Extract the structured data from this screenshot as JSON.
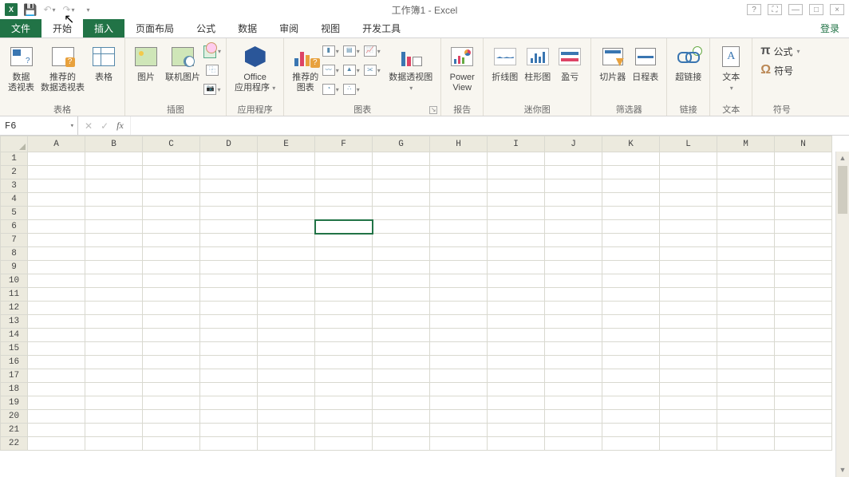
{
  "title": "工作簿1 - Excel",
  "login": "登录",
  "tabs": {
    "file": "文件",
    "home": "开始",
    "insert": "插入",
    "pagelayout": "页面布局",
    "formulas": "公式",
    "data": "数据",
    "review": "审阅",
    "view": "视图",
    "developer": "开发工具"
  },
  "active_tab": "insert",
  "ribbon": {
    "g_tables": {
      "label": "表格",
      "pivot": "数据\n透视表",
      "rec_pivot": "推荐的\n数据透视表",
      "table": "表格"
    },
    "g_illus": {
      "label": "插图",
      "pic": "图片",
      "online": "联机图片"
    },
    "g_apps": {
      "label": "应用程序",
      "office": "Office\n应用程序"
    },
    "g_charts": {
      "label": "图表",
      "rec": "推荐的\n图表",
      "pivotchart": "数据透视图"
    },
    "g_reports": {
      "label": "报告",
      "powerview": "Power\nView"
    },
    "g_spark": {
      "label": "迷你图",
      "line": "折线图",
      "column": "柱形图",
      "winloss": "盈亏"
    },
    "g_filters": {
      "label": "筛选器",
      "slicer": "切片器",
      "timeline": "日程表"
    },
    "g_links": {
      "label": "链接",
      "hyperlink": "超链接"
    },
    "g_text": {
      "label": "文本",
      "textbox": "文本"
    },
    "g_symbols": {
      "label": "符号",
      "equation": "公式",
      "symbol": "符号"
    }
  },
  "name_box": "F6",
  "columns": [
    "A",
    "B",
    "C",
    "D",
    "E",
    "F",
    "G",
    "H",
    "I",
    "J",
    "K",
    "L",
    "M",
    "N"
  ],
  "row_count": 22,
  "active_cell": {
    "row": 6,
    "col": "F"
  }
}
